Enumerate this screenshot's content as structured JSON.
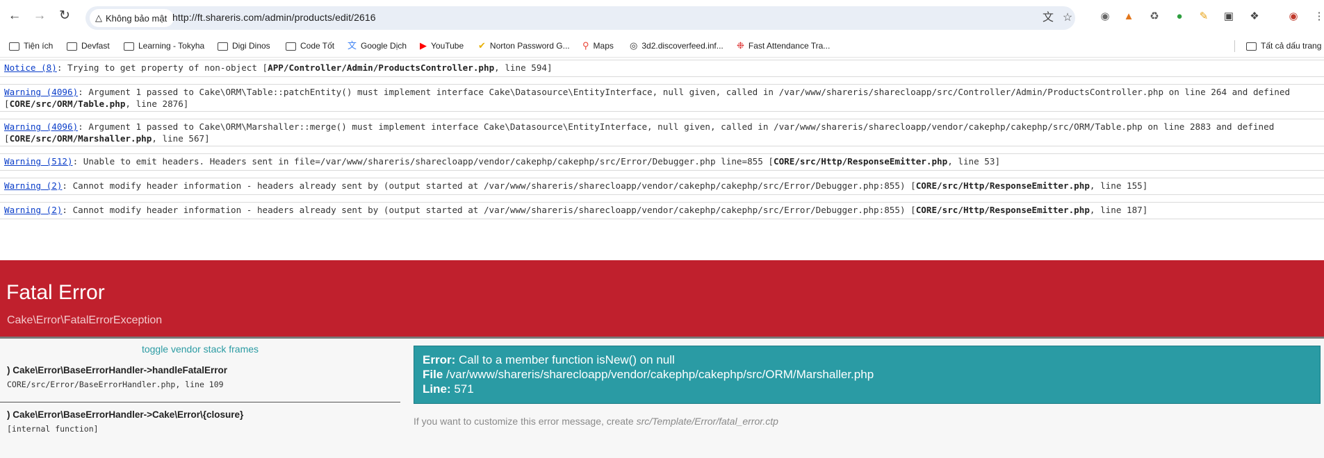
{
  "browser": {
    "security_label": "Không bảo mật",
    "url": "http://ft.shareris.com/admin/products/edit/2616",
    "bookmarks": [
      {
        "label": "Tiện ích",
        "icon": "apps-folder-icon"
      },
      {
        "label": "Devfast",
        "icon": "folder-icon"
      },
      {
        "label": "Learning - Tokyha",
        "icon": "folder-icon"
      },
      {
        "label": "Digi Dinos",
        "icon": "folder-icon"
      },
      {
        "label": "Code Tốt",
        "icon": "folder-icon"
      },
      {
        "label": "Google Dịch",
        "icon": "google-translate-icon"
      },
      {
        "label": "YouTube",
        "icon": "youtube-icon"
      },
      {
        "label": "Norton Password G...",
        "icon": "norton-icon"
      },
      {
        "label": "Maps",
        "icon": "maps-icon"
      },
      {
        "label": "3d2.discoverfeed.inf...",
        "icon": "globe-icon"
      },
      {
        "label": "Fast Attendance Tra...",
        "icon": "bookmark-icon"
      }
    ],
    "all_bookmarks_label": "Tất cả dấu trang"
  },
  "notices": [
    {
      "link": "Notice (8)",
      "parts": [
        {
          "t": ": Trying to get property of non-object [",
          "b": false
        },
        {
          "t": "APP/Controller/Admin/ProductsController.php",
          "b": true
        },
        {
          "t": ", line 594]",
          "b": false
        }
      ]
    },
    {
      "link": "Warning (4096)",
      "parts": [
        {
          "t": ": Argument 1 passed to Cake\\ORM\\Table::patchEntity() must implement interface Cake\\Datasource\\EntityInterface, null given, called in /var/www/shareris/sharecloapp/src/Controller/Admin/ProductsController.php on line 264 and defined [",
          "b": false
        },
        {
          "t": "CORE/src/ORM/Table.php",
          "b": true
        },
        {
          "t": ", line 2876]",
          "b": false
        }
      ]
    },
    {
      "link": "Warning (4096)",
      "parts": [
        {
          "t": ": Argument 1 passed to Cake\\ORM\\Marshaller::merge() must implement interface Cake\\Datasource\\EntityInterface, null given, called in /var/www/shareris/sharecloapp/vendor/cakephp/cakephp/src/ORM/Table.php on line 2883 and defined [",
          "b": false
        },
        {
          "t": "CORE/src/ORM/Marshaller.php",
          "b": true
        },
        {
          "t": ", line 567]",
          "b": false
        }
      ]
    },
    {
      "link": "Warning (512)",
      "parts": [
        {
          "t": ": Unable to emit headers. Headers sent in file=/var/www/shareris/sharecloapp/vendor/cakephp/cakephp/src/Error/Debugger.php line=855 [",
          "b": false
        },
        {
          "t": "CORE/src/Http/ResponseEmitter.php",
          "b": true
        },
        {
          "t": ", line 53]",
          "b": false
        }
      ]
    },
    {
      "link": "Warning (2)",
      "parts": [
        {
          "t": ": Cannot modify header information - headers already sent by (output started at /var/www/shareris/sharecloapp/vendor/cakephp/cakephp/src/Error/Debugger.php:855) [",
          "b": false
        },
        {
          "t": "CORE/src/Http/ResponseEmitter.php",
          "b": true
        },
        {
          "t": ", line 155]",
          "b": false
        }
      ]
    },
    {
      "link": "Warning (2)",
      "parts": [
        {
          "t": ": Cannot modify header information - headers already sent by (output started at /var/www/shareris/sharecloapp/vendor/cakephp/cakephp/src/Error/Debugger.php:855) [",
          "b": false
        },
        {
          "t": "CORE/src/Http/ResponseEmitter.php",
          "b": true
        },
        {
          "t": ", line 187]",
          "b": false
        }
      ]
    }
  ],
  "fatal": {
    "title": "Fatal Error",
    "exception": "Cake\\Error\\FatalErrorException"
  },
  "stack": {
    "toggle_label": "toggle vendor stack frames",
    "frames": [
      {
        "function": ") Cake\\Error\\BaseErrorHandler->handleFatalError",
        "file": "CORE/src/Error/BaseErrorHandler.php, line 109"
      },
      {
        "function": ") Cake\\Error\\BaseErrorHandler->Cake\\Error\\{closure}",
        "file": "[internal function]"
      }
    ]
  },
  "error": {
    "error_label": "Error:",
    "error_message": "Call to a member function isNew() on null",
    "file_label": "File",
    "file_path": "/var/www/shareris/sharecloapp/vendor/cakephp/cakephp/src/ORM/Marshaller.php",
    "line_label": "Line:",
    "line_number": "571"
  },
  "customize": {
    "text": "If you want to customize this error message, create ",
    "path": "src/Template/Error/fatal_error.ctp"
  }
}
